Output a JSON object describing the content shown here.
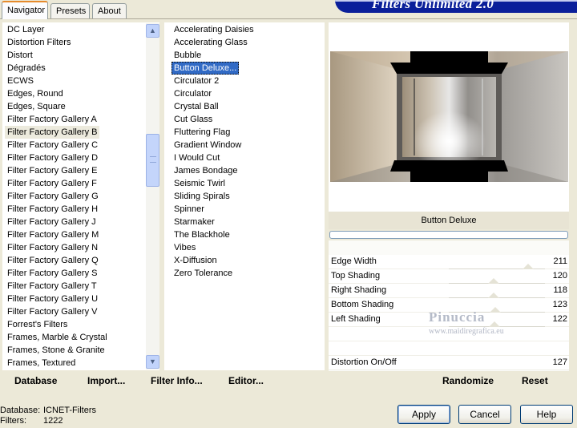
{
  "window": {
    "title": "Filters Unlimited 2.0"
  },
  "tabs": [
    {
      "label": "Navigator",
      "active": true
    },
    {
      "label": "Presets",
      "active": false
    },
    {
      "label": "About",
      "active": false
    }
  ],
  "categories": {
    "items": [
      "DC Layer",
      "Distortion Filters",
      "Distort",
      "Dégradés",
      "ECWS",
      "Edges, Round",
      "Edges, Square",
      "Filter Factory Gallery A",
      "Filter Factory Gallery B",
      "Filter Factory Gallery C",
      "Filter Factory Gallery D",
      "Filter Factory Gallery E",
      "Filter Factory Gallery F",
      "Filter Factory Gallery G",
      "Filter Factory Gallery H",
      "Filter Factory Gallery J",
      "Filter Factory Gallery M",
      "Filter Factory Gallery N",
      "Filter Factory Gallery Q",
      "Filter Factory Gallery S",
      "Filter Factory Gallery T",
      "Filter Factory Gallery U",
      "Filter Factory Gallery V",
      "Forrest's Filters",
      "Frames, Marble & Crystal",
      "Frames, Stone & Granite",
      "Frames, Textured"
    ],
    "selected": "Filter Factory Gallery B"
  },
  "filters": {
    "items": [
      "Accelerating Daisies",
      "Accelerating Glass",
      "Bubble",
      "Button Deluxe...",
      "Circulator 2",
      "Circulator",
      "Crystal Ball",
      "Cut Glass",
      "Fluttering Flag",
      "Gradient Window",
      "I Would Cut",
      "James Bondage",
      "Seismic Twirl",
      "Sliding Spirals",
      "Spinner",
      "Starmaker",
      "The Blackhole",
      "Vibes",
      "X-Diffusion",
      "Zero Tolerance"
    ],
    "selected": "Button Deluxe..."
  },
  "preview": {
    "filter_name": "Button Deluxe"
  },
  "params": [
    {
      "label": "Edge Width",
      "value": "211",
      "level": 211
    },
    {
      "label": "Top Shading",
      "value": "120",
      "level": 120
    },
    {
      "label": "Right Shading",
      "value": "118",
      "level": 118
    },
    {
      "label": "Bottom Shading",
      "value": "123",
      "level": 123
    },
    {
      "label": "Left Shading",
      "value": "122",
      "level": 122
    }
  ],
  "extra_param": {
    "label": "Distortion On/Off",
    "value": "127",
    "level": 127
  },
  "watermark": {
    "name": "Pinuccia",
    "url": "www.maidiregrafica.eu"
  },
  "toolbar": {
    "database": "Database",
    "import": "Import...",
    "filter_info": "Filter Info...",
    "editor": "Editor...",
    "randomize": "Randomize",
    "reset": "Reset"
  },
  "info": {
    "database_label": "Database:",
    "database_value": "ICNET-Filters",
    "filters_label": "Filters:",
    "filters_value": "1222"
  },
  "buttons": {
    "apply": "Apply",
    "cancel": "Cancel",
    "help": "Help"
  }
}
